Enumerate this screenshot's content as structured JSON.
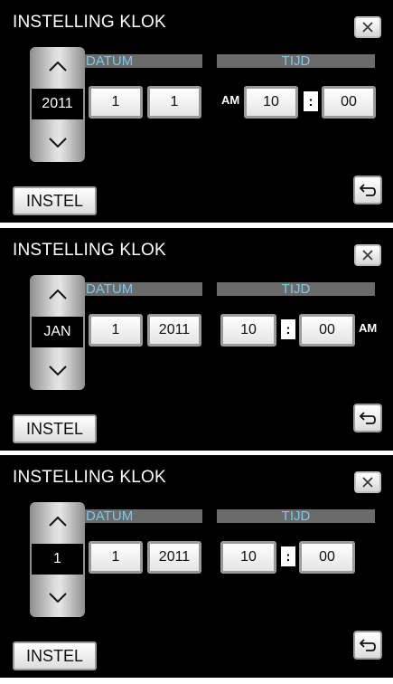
{
  "panels": [
    {
      "title": "INSTELLING KLOK",
      "stepper_value": "2011",
      "header": {
        "datum": "DATUM",
        "tijd": "TIJD"
      },
      "date_fields": [
        "1",
        "1"
      ],
      "ampm": "AM",
      "hour": "10",
      "colon": ":",
      "minute": "00",
      "set_label": "INSTEL"
    },
    {
      "title": "INSTELLING KLOK",
      "stepper_value": "JAN",
      "header": {
        "datum": "DATUM",
        "tijd": "TIJD"
      },
      "date_fields": [
        "1",
        "2011"
      ],
      "ampm": "AM",
      "hour": "10",
      "colon": ":",
      "minute": "00",
      "set_label": "INSTEL"
    },
    {
      "title": "INSTELLING KLOK",
      "stepper_value": "1",
      "header": {
        "datum": "DATUM",
        "tijd": "TIJD"
      },
      "date_fields": [
        "1",
        "2011"
      ],
      "hour": "10",
      "colon": ":",
      "minute": "00",
      "set_label": "INSTEL"
    }
  ],
  "icons": {
    "close": "close-icon",
    "up": "chevron-up-icon",
    "down": "chevron-down-icon",
    "back": "return-arrow-icon"
  },
  "colors": {
    "background": "#000000",
    "header_bar": "#6b6b6b",
    "header_text": "#7ec8e8",
    "button_face": "#ffffff"
  }
}
